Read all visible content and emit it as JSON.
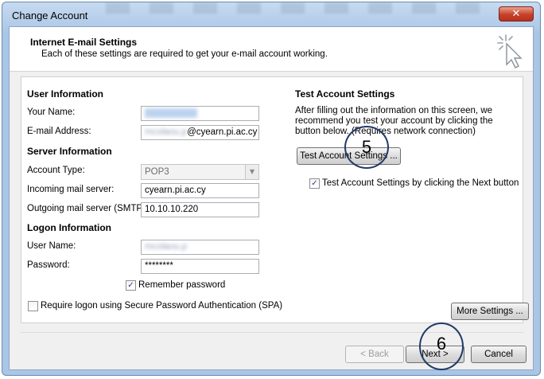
{
  "window": {
    "title": "Change Account",
    "close_glyph": "✕"
  },
  "header": {
    "title": "Internet E-mail Settings",
    "subtitle": "Each of these settings are required to get your e-mail account working.",
    "icon": "cursor-click-icon"
  },
  "user_info": {
    "heading": "User Information",
    "name_label": "Your Name:",
    "name_value": "Pamerrmnny",
    "email_label": "E-mail Address:",
    "email_prefix": "mcolaou.p",
    "email_domain": "@cyearn.pi.ac.cy"
  },
  "server_info": {
    "heading": "Server Information",
    "account_type_label": "Account Type:",
    "account_type_value": "POP3",
    "incoming_label": "Incoming mail server:",
    "incoming_value": "cyearn.pi.ac.cy",
    "outgoing_label": "Outgoing mail server (SMTP):",
    "outgoing_value": "10.10.10.220"
  },
  "logon_info": {
    "heading": "Logon Information",
    "username_label": "User Name:",
    "username_value": "mcolaou.p",
    "password_label": "Password:",
    "password_value": "********",
    "remember_label": "Remember password",
    "remember_checked": true,
    "spa_label": "Require logon using Secure Password Authentication (SPA)",
    "spa_checked": false
  },
  "test_settings": {
    "heading": "Test Account Settings",
    "description": "After filling out the information on this screen, we recommend you test your account by clicking the button below. (Requires network connection)",
    "test_button": "Test Account Settings ...",
    "auto_test_label": "Test Account Settings by clicking the Next button",
    "auto_test_checked": true
  },
  "buttons": {
    "more_settings": "More Settings ...",
    "back": "< Back",
    "next": "Next >",
    "cancel": "Cancel"
  },
  "annotations": {
    "step5": "5",
    "step6": "6",
    "color": "#223a66"
  },
  "check_glyph": "✓"
}
